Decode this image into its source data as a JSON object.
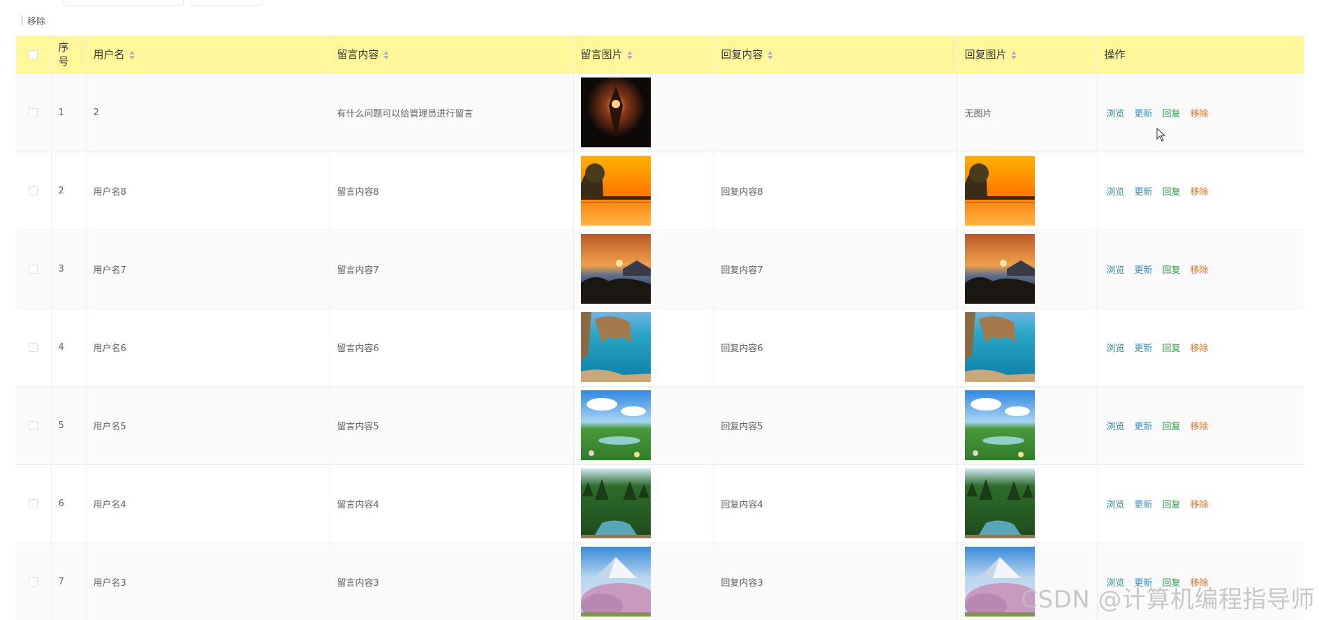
{
  "toolbar": {
    "remove_label": "移除"
  },
  "table": {
    "headers": {
      "index": "序号",
      "username": "用户名",
      "message": "留言内容",
      "message_image": "留言图片",
      "reply": "回复内容",
      "reply_image": "回复图片",
      "actions": "操作"
    },
    "row_actions": {
      "view": "浏览",
      "edit": "更新",
      "reply": "回复",
      "remove": "移除"
    },
    "rows": [
      {
        "index": "1",
        "username": "2",
        "message": "有什么问题可以给管理员进行留言",
        "message_image": "dark-fantasy-art-thumbnail",
        "reply": "",
        "reply_image_text": "无图片",
        "reply_image": ""
      },
      {
        "index": "2",
        "username": "用户名8",
        "message": "留言内容8",
        "message_image": "sunset-lake-thumbnail",
        "reply": "回复内容8",
        "reply_image_text": "",
        "reply_image": "sunset-lake-thumbnail"
      },
      {
        "index": "3",
        "username": "用户名7",
        "message": "留言内容7",
        "message_image": "sunset-coast-thumbnail",
        "reply": "回复内容7",
        "reply_image_text": "",
        "reply_image": "sunset-coast-thumbnail"
      },
      {
        "index": "4",
        "username": "用户名6",
        "message": "留言内容6",
        "message_image": "sea-arch-thumbnail",
        "reply": "回复内容6",
        "reply_image_text": "",
        "reply_image": "sea-arch-thumbnail"
      },
      {
        "index": "5",
        "username": "用户名5",
        "message": "留言内容5",
        "message_image": "meadow-sky-thumbnail",
        "reply": "回复内容5",
        "reply_image_text": "",
        "reply_image": "meadow-sky-thumbnail"
      },
      {
        "index": "6",
        "username": "用户名4",
        "message": "留言内容4",
        "message_image": "forest-river-thumbnail",
        "reply": "回复内容4",
        "reply_image_text": "",
        "reply_image": "forest-river-thumbnail"
      },
      {
        "index": "7",
        "username": "用户名3",
        "message": "留言内容3",
        "message_image": "mountain-blossom-thumbnail",
        "reply": "回复内容3",
        "reply_image_text": "",
        "reply_image": "mountain-blossom-thumbnail"
      }
    ]
  },
  "watermark": "CSDN @计算机编程指导师"
}
